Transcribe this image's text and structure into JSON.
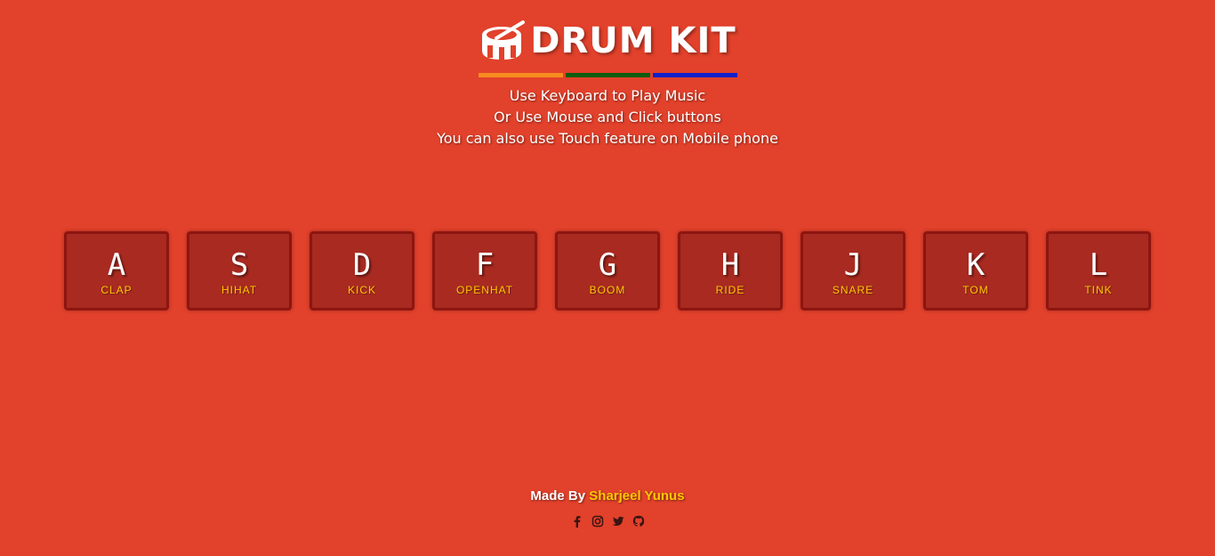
{
  "header": {
    "title": "DRUM KIT",
    "icon": "drum-icon",
    "stripe_colors": [
      "#f68c1e",
      "#0b5d0e",
      "#0f20c8"
    ],
    "instructions": [
      "Use Keyboard to Play Music",
      "Or Use Mouse and Click buttons",
      "You can also use Touch feature on Mobile phone"
    ]
  },
  "keys": [
    {
      "letter": "A",
      "sound": "CLAP"
    },
    {
      "letter": "S",
      "sound": "HIHAT"
    },
    {
      "letter": "D",
      "sound": "KICK"
    },
    {
      "letter": "F",
      "sound": "OPENHAT"
    },
    {
      "letter": "G",
      "sound": "BOOM"
    },
    {
      "letter": "H",
      "sound": "RIDE"
    },
    {
      "letter": "J",
      "sound": "SNARE"
    },
    {
      "letter": "K",
      "sound": "TOM"
    },
    {
      "letter": "L",
      "sound": "TINK"
    }
  ],
  "footer": {
    "made_by": "Made By",
    "author": "Sharjeel Yunus",
    "social_icons": [
      "facebook-icon",
      "instagram-icon",
      "twitter-icon",
      "github-icon"
    ]
  },
  "colors": {
    "background": "#e2412b",
    "key_background": "#a82a20",
    "key_border": "#8e1510",
    "accent": "#ffc600"
  }
}
